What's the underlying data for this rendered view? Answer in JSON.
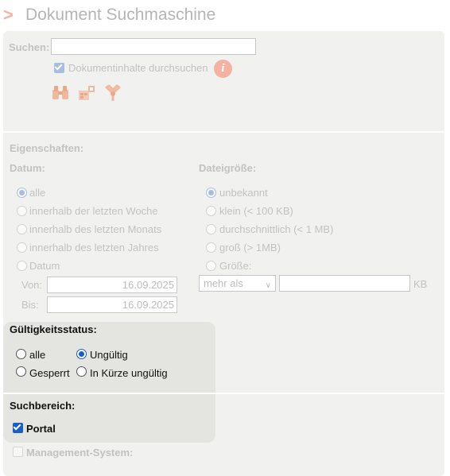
{
  "title": "Dokument Suchmaschine",
  "search": {
    "label": "Suchen:",
    "value": "",
    "content_checkbox_label": "Dokumentinhalte durchsuchen",
    "content_checkbox_checked": true,
    "tools": [
      "binoculars-icon",
      "catalog-icon",
      "clear-icon"
    ]
  },
  "properties": {
    "heading": "Eigenschaften:",
    "date": {
      "heading": "Datum:",
      "options": [
        "alle",
        "innerhalb der letzten Woche",
        "innerhalb des letzten Monats",
        "innerhalb des letzten Jahres",
        "Datum"
      ],
      "selected": "alle",
      "from_label": "Von:",
      "from_value": "16.09.2025",
      "to_label": "Bis:",
      "to_value": "16.09.2025"
    },
    "size": {
      "heading": "Dateigröße:",
      "options": [
        "unbekannt",
        "klein (< 100 KB)",
        "durchschnittlich (< 1 MB)",
        "groß (> 1MB)",
        "Größe:"
      ],
      "selected": "unbekannt",
      "comparator": "mehr als",
      "value": "",
      "unit": "KB"
    }
  },
  "validity": {
    "heading": "Gültigkeitsstatus:",
    "options": [
      "alle",
      "Ungültig",
      "Gesperrt",
      "In Kürze ungültig"
    ],
    "selected": "Ungültig"
  },
  "scope": {
    "heading": "Suchbereich:",
    "portal_label": "Portal",
    "portal_checked": true,
    "management_label": "Management-System:",
    "management_checked": false
  },
  "colors": {
    "accent": "#1a5fc8",
    "title_arrow": "#f2b6a6",
    "info_icon": "#f4b2a1",
    "panel": "#f1f1ef",
    "highlight": "#e4e5e0"
  }
}
